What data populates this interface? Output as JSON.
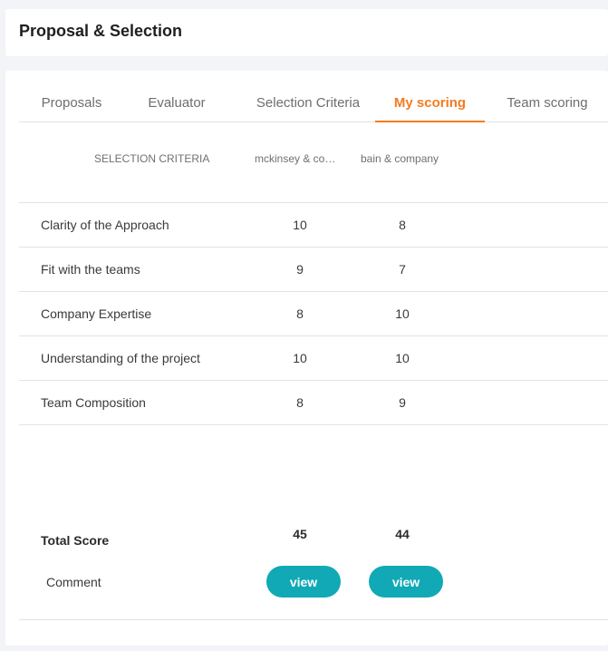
{
  "header": {
    "title": "Proposal & Selection"
  },
  "tabs": [
    {
      "label": "Proposals"
    },
    {
      "label": "Evaluator"
    },
    {
      "label": "Selection Criteria"
    },
    {
      "label": "My scoring"
    },
    {
      "label": "Team scoring"
    }
  ],
  "active_tab": "My scoring",
  "table": {
    "headers": [
      "SELECTION CRITERIA",
      "mckinsey & company",
      "bain & company"
    ],
    "rows": [
      {
        "criterion": "Clarity of the Approach",
        "scores": [
          "10",
          "8"
        ]
      },
      {
        "criterion": "Fit with the teams",
        "scores": [
          "9",
          "7"
        ]
      },
      {
        "criterion": "Company Expertise",
        "scores": [
          "8",
          "10"
        ]
      },
      {
        "criterion": "Understanding of the project",
        "scores": [
          "10",
          "10"
        ]
      },
      {
        "criterion": "Team Composition",
        "scores": [
          "8",
          "9"
        ]
      }
    ],
    "total_label": "Total Score",
    "totals": [
      "45",
      "44"
    ],
    "comment_label": "Comment",
    "view_label": "view"
  },
  "colors": {
    "accent": "#f47b20",
    "button": "#10a9b5",
    "background": "#f2f4f7"
  }
}
